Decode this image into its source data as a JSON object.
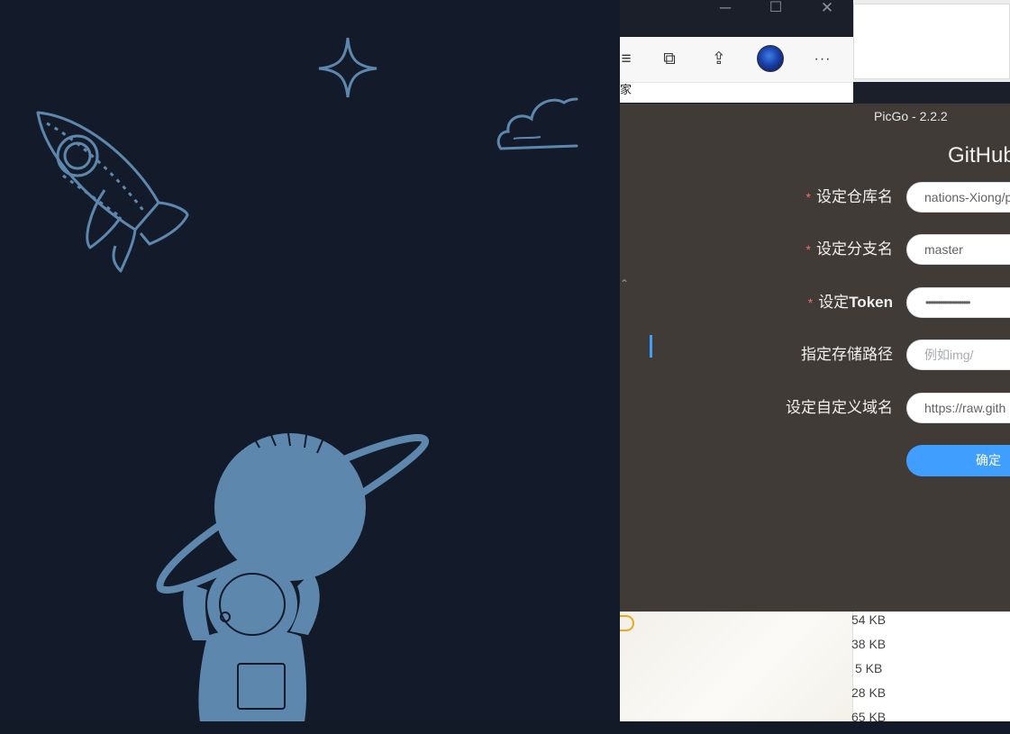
{
  "picgo": {
    "window_title": "PicGo - 2.2.2",
    "heading": "GitHub",
    "form": {
      "repo": {
        "label": "设定仓库名",
        "required": true,
        "value": "nations-Xiong/p"
      },
      "branch": {
        "label": "设定分支名",
        "required": true,
        "value": "master"
      },
      "token": {
        "label_prefix": "设定",
        "label_bold": "Token",
        "required": true,
        "value": "••••••••••••••••••••••"
      },
      "path": {
        "label": "指定存储路径",
        "required": false,
        "placeholder": "例如img/"
      },
      "custom_url": {
        "label": "设定自定义域名",
        "required": false,
        "value": "https://raw.gith"
      }
    },
    "required_mark": "*",
    "confirm_label": "确定",
    "collapse_glyph": "⌃"
  },
  "browser": {
    "minimize_glyph": "─",
    "maximize_glyph": "☐",
    "close_glyph": "✕",
    "favorites_text": "家",
    "menu_glyph": "≡",
    "collections_glyph": "⧉",
    "share_glyph": "⇪",
    "more_glyph": "···"
  },
  "files": {
    "sizes": [
      "54 KB",
      "38 KB",
      "5 KB",
      "28 KB",
      "65 KB"
    ]
  },
  "colors": {
    "accent": "#409eff",
    "required": "#f56c6c",
    "picgo_bg": "#403b37",
    "wallpaper_bg": "#131b2a",
    "illustration": "#5e87ae"
  }
}
